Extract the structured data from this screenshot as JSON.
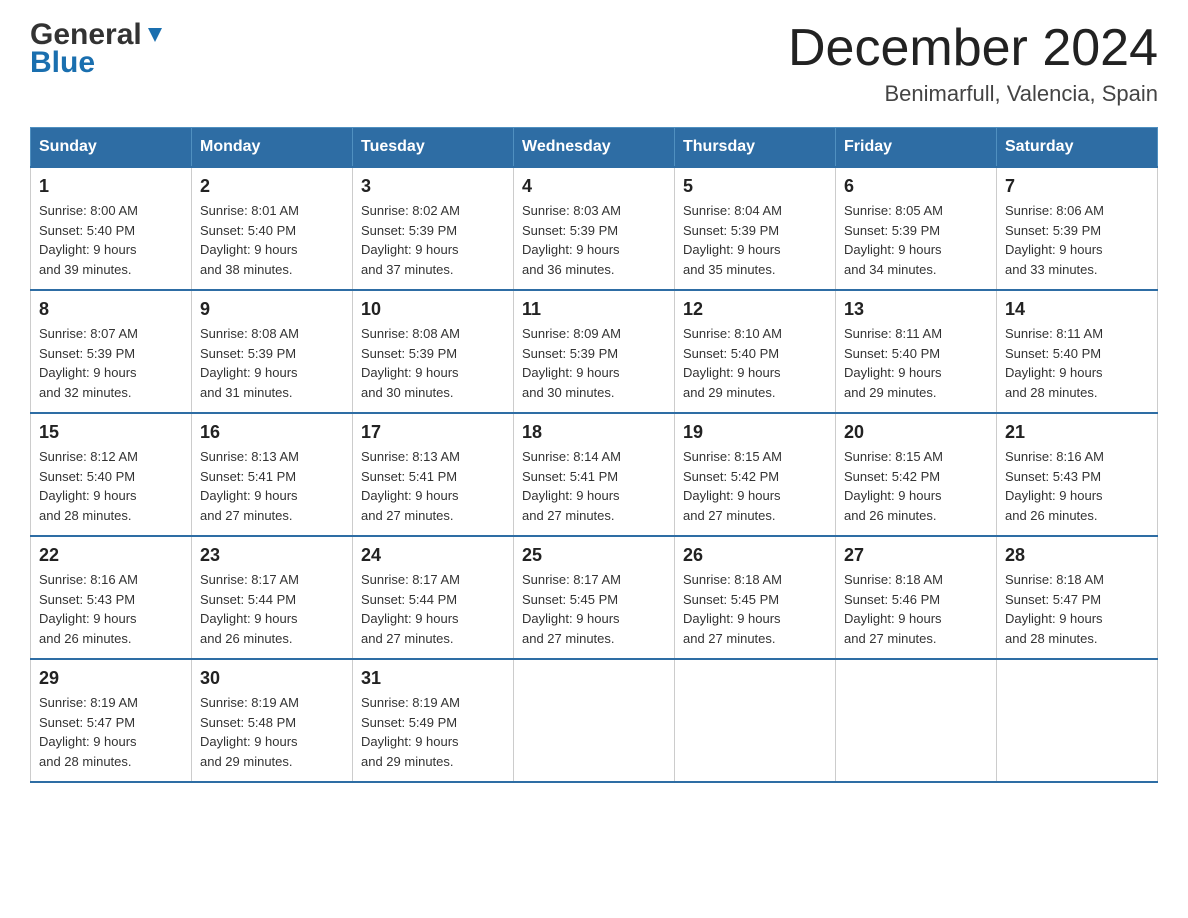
{
  "header": {
    "logo_general": "General",
    "logo_blue": "Blue",
    "month_title": "December 2024",
    "location": "Benimarfull, Valencia, Spain"
  },
  "days_of_week": [
    "Sunday",
    "Monday",
    "Tuesday",
    "Wednesday",
    "Thursday",
    "Friday",
    "Saturday"
  ],
  "weeks": [
    [
      {
        "day": "1",
        "sunrise": "8:00 AM",
        "sunset": "5:40 PM",
        "daylight_hours": "9",
        "daylight_minutes": "39"
      },
      {
        "day": "2",
        "sunrise": "8:01 AM",
        "sunset": "5:40 PM",
        "daylight_hours": "9",
        "daylight_minutes": "38"
      },
      {
        "day": "3",
        "sunrise": "8:02 AM",
        "sunset": "5:39 PM",
        "daylight_hours": "9",
        "daylight_minutes": "37"
      },
      {
        "day": "4",
        "sunrise": "8:03 AM",
        "sunset": "5:39 PM",
        "daylight_hours": "9",
        "daylight_minutes": "36"
      },
      {
        "day": "5",
        "sunrise": "8:04 AM",
        "sunset": "5:39 PM",
        "daylight_hours": "9",
        "daylight_minutes": "35"
      },
      {
        "day": "6",
        "sunrise": "8:05 AM",
        "sunset": "5:39 PM",
        "daylight_hours": "9",
        "daylight_minutes": "34"
      },
      {
        "day": "7",
        "sunrise": "8:06 AM",
        "sunset": "5:39 PM",
        "daylight_hours": "9",
        "daylight_minutes": "33"
      }
    ],
    [
      {
        "day": "8",
        "sunrise": "8:07 AM",
        "sunset": "5:39 PM",
        "daylight_hours": "9",
        "daylight_minutes": "32"
      },
      {
        "day": "9",
        "sunrise": "8:08 AM",
        "sunset": "5:39 PM",
        "daylight_hours": "9",
        "daylight_minutes": "31"
      },
      {
        "day": "10",
        "sunrise": "8:08 AM",
        "sunset": "5:39 PM",
        "daylight_hours": "9",
        "daylight_minutes": "30"
      },
      {
        "day": "11",
        "sunrise": "8:09 AM",
        "sunset": "5:39 PM",
        "daylight_hours": "9",
        "daylight_minutes": "30"
      },
      {
        "day": "12",
        "sunrise": "8:10 AM",
        "sunset": "5:40 PM",
        "daylight_hours": "9",
        "daylight_minutes": "29"
      },
      {
        "day": "13",
        "sunrise": "8:11 AM",
        "sunset": "5:40 PM",
        "daylight_hours": "9",
        "daylight_minutes": "29"
      },
      {
        "day": "14",
        "sunrise": "8:11 AM",
        "sunset": "5:40 PM",
        "daylight_hours": "9",
        "daylight_minutes": "28"
      }
    ],
    [
      {
        "day": "15",
        "sunrise": "8:12 AM",
        "sunset": "5:40 PM",
        "daylight_hours": "9",
        "daylight_minutes": "28"
      },
      {
        "day": "16",
        "sunrise": "8:13 AM",
        "sunset": "5:41 PM",
        "daylight_hours": "9",
        "daylight_minutes": "27"
      },
      {
        "day": "17",
        "sunrise": "8:13 AM",
        "sunset": "5:41 PM",
        "daylight_hours": "9",
        "daylight_minutes": "27"
      },
      {
        "day": "18",
        "sunrise": "8:14 AM",
        "sunset": "5:41 PM",
        "daylight_hours": "9",
        "daylight_minutes": "27"
      },
      {
        "day": "19",
        "sunrise": "8:15 AM",
        "sunset": "5:42 PM",
        "daylight_hours": "9",
        "daylight_minutes": "27"
      },
      {
        "day": "20",
        "sunrise": "8:15 AM",
        "sunset": "5:42 PM",
        "daylight_hours": "9",
        "daylight_minutes": "26"
      },
      {
        "day": "21",
        "sunrise": "8:16 AM",
        "sunset": "5:43 PM",
        "daylight_hours": "9",
        "daylight_minutes": "26"
      }
    ],
    [
      {
        "day": "22",
        "sunrise": "8:16 AM",
        "sunset": "5:43 PM",
        "daylight_hours": "9",
        "daylight_minutes": "26"
      },
      {
        "day": "23",
        "sunrise": "8:17 AM",
        "sunset": "5:44 PM",
        "daylight_hours": "9",
        "daylight_minutes": "26"
      },
      {
        "day": "24",
        "sunrise": "8:17 AM",
        "sunset": "5:44 PM",
        "daylight_hours": "9",
        "daylight_minutes": "27"
      },
      {
        "day": "25",
        "sunrise": "8:17 AM",
        "sunset": "5:45 PM",
        "daylight_hours": "9",
        "daylight_minutes": "27"
      },
      {
        "day": "26",
        "sunrise": "8:18 AM",
        "sunset": "5:45 PM",
        "daylight_hours": "9",
        "daylight_minutes": "27"
      },
      {
        "day": "27",
        "sunrise": "8:18 AM",
        "sunset": "5:46 PM",
        "daylight_hours": "9",
        "daylight_minutes": "27"
      },
      {
        "day": "28",
        "sunrise": "8:18 AM",
        "sunset": "5:47 PM",
        "daylight_hours": "9",
        "daylight_minutes": "28"
      }
    ],
    [
      {
        "day": "29",
        "sunrise": "8:19 AM",
        "sunset": "5:47 PM",
        "daylight_hours": "9",
        "daylight_minutes": "28"
      },
      {
        "day": "30",
        "sunrise": "8:19 AM",
        "sunset": "5:48 PM",
        "daylight_hours": "9",
        "daylight_minutes": "29"
      },
      {
        "day": "31",
        "sunrise": "8:19 AM",
        "sunset": "5:49 PM",
        "daylight_hours": "9",
        "daylight_minutes": "29"
      },
      null,
      null,
      null,
      null
    ]
  ]
}
